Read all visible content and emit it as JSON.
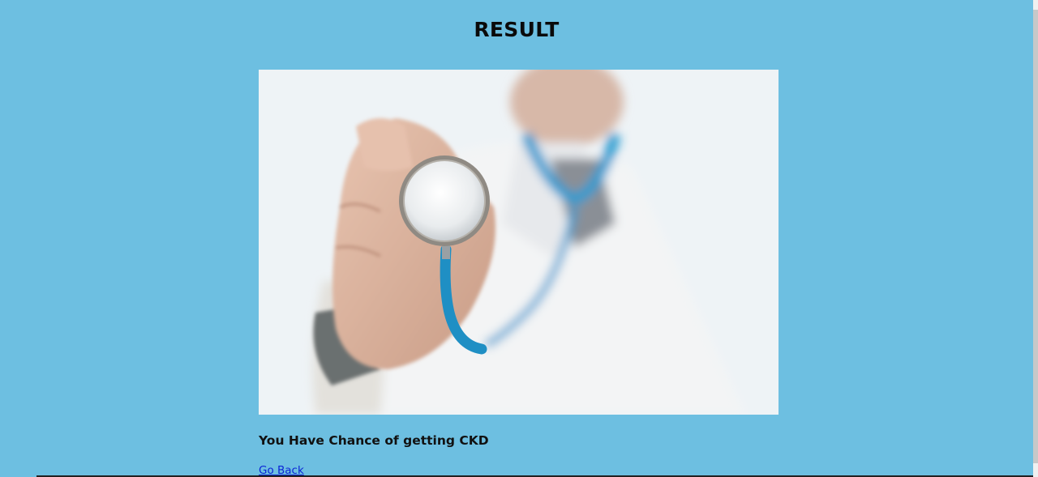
{
  "page": {
    "title": "RESULT",
    "message": "You Have Chance of getting CKD",
    "back_link": "Go Back"
  },
  "image": {
    "subject": "doctor-holding-stethoscope"
  },
  "colors": {
    "background": "#6dbfe1",
    "link": "#0b24d6",
    "stethoscope_tube": "#2a9bd0"
  }
}
